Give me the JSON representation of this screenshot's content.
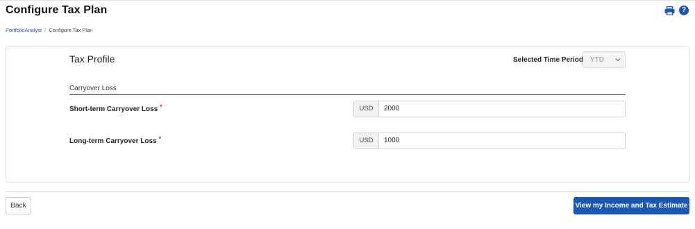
{
  "header": {
    "title": "Configure Tax Plan",
    "print_icon": "printer-icon",
    "help_icon": "question-circle-icon",
    "help_glyph": "?"
  },
  "breadcrumb": {
    "items": [
      "PortfolioAnalyst",
      "Configure Tax Plan"
    ],
    "separator": "/"
  },
  "tax_profile": {
    "title": "Tax Profile",
    "period_label": "Selected Time Period",
    "period_value": "YTD",
    "section_label": "Carryover Loss",
    "fields": [
      {
        "label": "Short-term Carryover Loss",
        "required_mark": "*",
        "currency": "USD",
        "value": "2000"
      },
      {
        "label": "Long-term Carryover Loss",
        "required_mark": "*",
        "currency": "USD",
        "value": "1000"
      }
    ]
  },
  "footer": {
    "back_label": "Back",
    "submit_label": "View my Income and Tax Estimate"
  },
  "colors": {
    "accent": "#1a56b4",
    "required": "#d0302a"
  }
}
